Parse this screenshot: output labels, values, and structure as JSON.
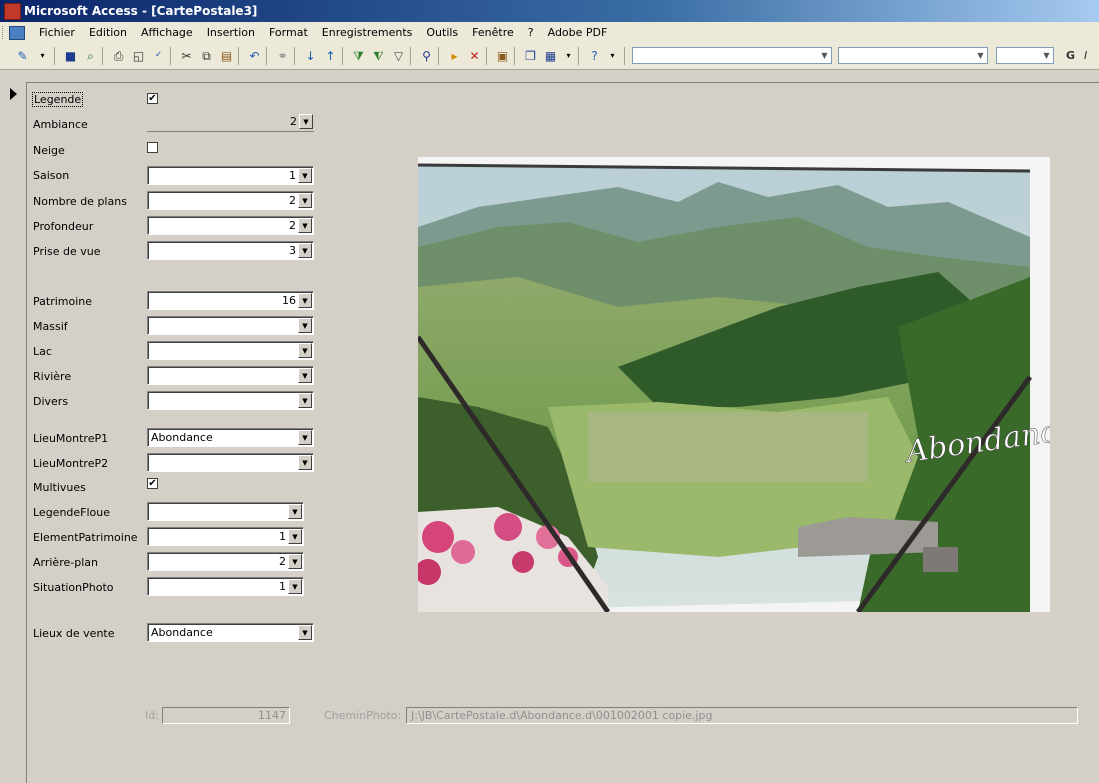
{
  "window": {
    "title": "Microsoft Access - [CartePostale3]"
  },
  "menu": [
    "Fichier",
    "Edition",
    "Affichage",
    "Insertion",
    "Format",
    "Enregistrements",
    "Outils",
    "Fenêtre",
    "?",
    "Adobe PDF"
  ],
  "toolbar": {
    "icons": [
      "design-view-icon",
      "save-icon",
      "search-file-icon",
      "print-icon",
      "print-preview-icon",
      "spelling-icon",
      "cut-icon",
      "copy-icon",
      "paste-icon",
      "undo-icon",
      "hyperlink-icon",
      "sort-ascending-icon",
      "sort-descending-icon",
      "filter-by-selection-icon",
      "filter-by-form-icon",
      "apply-filter-icon",
      "find-icon",
      "new-record-icon",
      "delete-record-icon",
      "properties-icon",
      "database-window-icon",
      "new-object-icon",
      "help-icon"
    ],
    "bold_letter": "G",
    "italic_letter": "I"
  },
  "form": {
    "legende": {
      "label": "Legende",
      "checked": "✔"
    },
    "ambiance": {
      "label": "Ambiance",
      "value": "2"
    },
    "neige": {
      "label": "Neige",
      "checked": ""
    },
    "saison": {
      "label": "Saison",
      "value": "1"
    },
    "nombre_plans": {
      "label": "Nombre de plans",
      "value": "2"
    },
    "profondeur": {
      "label": "Profondeur",
      "value": "2"
    },
    "prise_vue": {
      "label": "Prise de vue",
      "value": "3"
    },
    "patrimoine": {
      "label": "Patrimoine",
      "value": "16"
    },
    "massif": {
      "label": "Massif",
      "value": ""
    },
    "lac": {
      "label": "Lac",
      "value": ""
    },
    "riviere": {
      "label": "Rivière",
      "value": ""
    },
    "divers": {
      "label": "Divers",
      "value": ""
    },
    "lieu_p1": {
      "label": "LieuMontreP1",
      "value": "Abondance"
    },
    "lieu_p2": {
      "label": "LieuMontreP2",
      "value": ""
    },
    "multivues": {
      "label": "Multivues",
      "checked": "✔"
    },
    "legende_floue": {
      "label": "LegendeFloue",
      "value": ""
    },
    "element_patrimoine": {
      "label": "ElementPatrimoine",
      "value": "1"
    },
    "arriere_plan": {
      "label": "Arrière-plan",
      "value": "2"
    },
    "situation_photo": {
      "label": "SituationPhoto",
      "value": "1"
    },
    "lieux_vente": {
      "label": "Lieux  de vente",
      "value": "Abondance"
    },
    "id": {
      "label": "Id:",
      "value": "1147"
    },
    "chemin_photo": {
      "label": "CheminPhoto:",
      "value": "J:\\JB\\CartePostale.d\\Abondance.d\\001002001 copie.jpg"
    }
  },
  "photo": {
    "caption": "Abondance"
  },
  "colors": {
    "title_start": "#0a246a",
    "title_end": "#a6caf0",
    "window_bg": "#d4d0c8"
  }
}
